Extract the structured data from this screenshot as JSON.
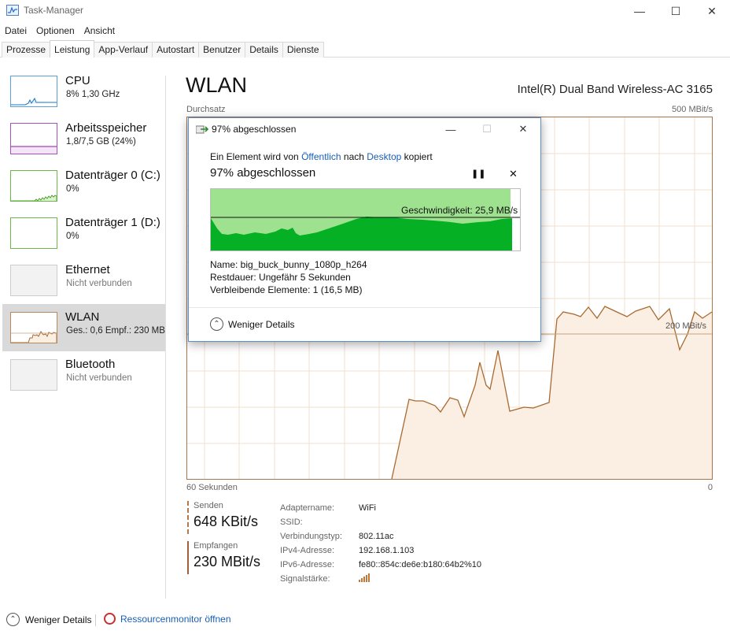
{
  "window": {
    "title": "Task-Manager"
  },
  "menu": {
    "items": [
      "Datei",
      "Optionen",
      "Ansicht"
    ]
  },
  "tabs": [
    "Prozesse",
    "Leistung",
    "App-Verlauf",
    "Autostart",
    "Benutzer",
    "Details",
    "Dienste"
  ],
  "active_tab": "Leistung",
  "sidebar": {
    "items": [
      {
        "title": "CPU",
        "sub": "8% 1,30 GHz",
        "color": "#1a78c2"
      },
      {
        "title": "Arbeitsspeicher",
        "sub": "1,8/7,5 GB (24%)",
        "color": "#8b1aa6"
      },
      {
        "title": "Datenträger 0 (C:)",
        "sub": "0%",
        "color": "#4da028"
      },
      {
        "title": "Datenträger 1 (D:)",
        "sub": "0%",
        "color": "#4da028"
      },
      {
        "title": "Ethernet",
        "sub": "Nicht verbunden",
        "color": "#a0a0a0"
      },
      {
        "title": "WLAN",
        "sub": "Ges.: 0,6 Empf.: 230 MB",
        "color": "#a86a32"
      },
      {
        "title": "Bluetooth",
        "sub": "Nicht verbunden",
        "color": "#a0a0a0"
      }
    ],
    "selected": "WLAN"
  },
  "main": {
    "title": "WLAN",
    "adapter_model": "Intel(R) Dual Band Wireless-AC 3165",
    "graph_label": "Durchsatz",
    "graph_max": "500 MBit/s",
    "graph_mid": "200 MBit/s",
    "time_left": "60 Sekunden",
    "time_right": "0"
  },
  "stats": {
    "send_label": "Senden",
    "send_value": "648 KBit/s",
    "recv_label": "Empfangen",
    "recv_value": "230 MBit/s"
  },
  "properties": {
    "adapter_label": "Adaptername:",
    "adapter_value": "WiFi",
    "ssid_label": "SSID:",
    "ssid_value": "",
    "conn_label": "Verbindungstyp:",
    "conn_value": "802.11ac",
    "ipv4_label": "IPv4-Adresse:",
    "ipv4_value": "192.168.1.103",
    "ipv6_label": "IPv6-Adresse:",
    "ipv6_value": "fe80::854c:de6e:b180:64b2%10",
    "signal_label": "Signalstärke:"
  },
  "footer": {
    "less_details": "Weniger Details",
    "resource_monitor": "Ressourcenmonitor öffnen"
  },
  "dialog": {
    "title": "97% abgeschlossen",
    "from_prefix": "Ein Element wird von",
    "from_source": "Öffentlich",
    "from_mid": "nach",
    "from_target": "Desktop",
    "from_suffix": "kopiert",
    "progress_text": "97% abgeschlossen",
    "progress": 0.97,
    "speed": "Geschwindigkeit: 25,9 MB/s",
    "name_line": "Name:  big_buck_bunny_1080p_h264",
    "remaining_line": "Restdauer: Ungefähr 5 Sekunden",
    "items_line": "Verbleibende Elemente: 1 (16,5 MB)",
    "less_details": "Weniger Details"
  },
  "colors": {
    "wlan_line": "#a86a32",
    "wlan_fill": "#fbeee3",
    "copy_green": "#06b025",
    "copy_green_light": "#9ee28f",
    "link": "#1a5fb4"
  }
}
